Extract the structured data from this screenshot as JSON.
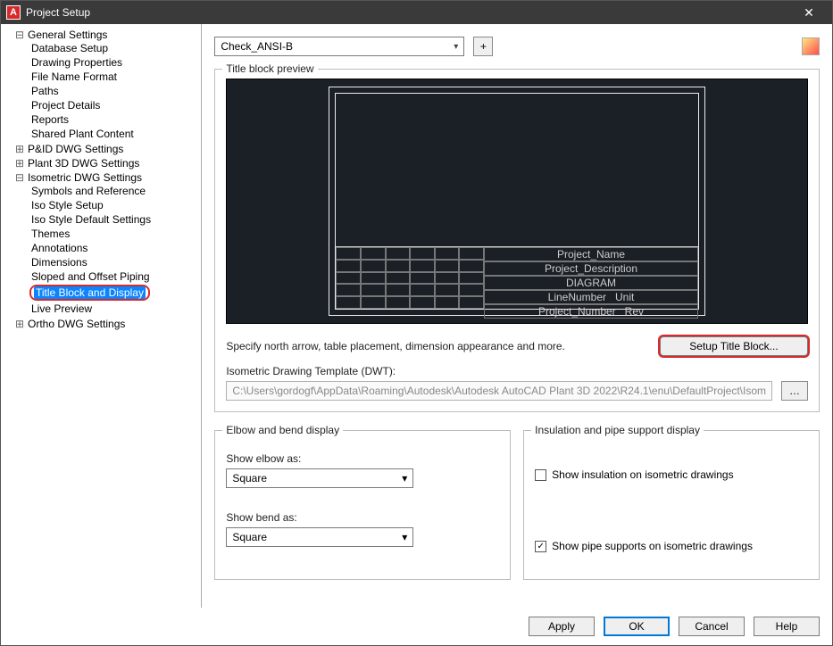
{
  "titlebar": {
    "title": "Project Setup"
  },
  "tree": {
    "general": {
      "label": "General Settings",
      "children": [
        "Database Setup",
        "Drawing Properties",
        "File Name Format",
        "Paths",
        "Project Details",
        "Reports",
        "Shared Plant Content"
      ]
    },
    "pid": "P&ID DWG Settings",
    "plant3d": "Plant 3D DWG Settings",
    "iso": {
      "label": "Isometric DWG Settings",
      "children": [
        "Symbols and Reference",
        "Iso Style Setup",
        "Iso Style Default Settings",
        "Themes",
        "Annotations",
        "Dimensions",
        "Sloped and Offset Piping",
        "Title Block and Display",
        "Live Preview"
      ]
    },
    "ortho": "Ortho DWG Settings"
  },
  "topCombo": {
    "value": "Check_ANSI-B"
  },
  "previewGroup": {
    "legend": "Title block preview"
  },
  "titleBlockFields": {
    "proj_name": "Project_Name",
    "proj_desc": "Project_Description",
    "diagram": "DIAGRAM",
    "line_num": "LineNumber",
    "unit": "Unit",
    "proj_num": "Project_Number",
    "rev": "Rev"
  },
  "specText": "Specify north arrow, table placement, dimension appearance and more.",
  "setupBtn": "Setup Title Block...",
  "dwtLabel": "Isometric Drawing Template (DWT):",
  "dwtPath": "C:\\Users\\gordogf\\AppData\\Roaming\\Autodesk\\Autodesk AutoCAD Plant 3D 2022\\R24.1\\enu\\DefaultProject\\Isom",
  "elbowGroup": {
    "legend": "Elbow and bend display",
    "elbowLbl": "Show elbow as:",
    "elbowVal": "Square",
    "bendLbl": "Show bend as:",
    "bendVal": "Square"
  },
  "insGroup": {
    "legend": "Insulation and pipe support display",
    "cb1": "Show insulation on isometric drawings",
    "cb2": "Show pipe supports on isometric drawings"
  },
  "footer": {
    "apply": "Apply",
    "ok": "OK",
    "cancel": "Cancel",
    "help": "Help"
  }
}
